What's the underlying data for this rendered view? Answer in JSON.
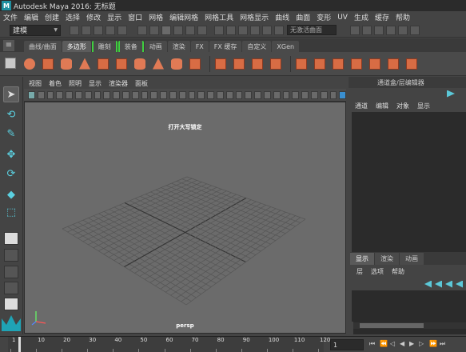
{
  "window": {
    "title": "Autodesk Maya 2016: 无标题",
    "app_icon_letter": "M"
  },
  "menubar": {
    "items": [
      "文件",
      "编辑",
      "创建",
      "选择",
      "修改",
      "显示",
      "窗口",
      "网格",
      "编辑网格",
      "网格工具",
      "网格显示",
      "曲线",
      "曲面",
      "变形",
      "UV",
      "生成",
      "缓存",
      "帮助"
    ]
  },
  "statusline": {
    "mode": "建模",
    "live_surface": "无激活曲面"
  },
  "shelf": {
    "tabs": [
      "曲线/曲面",
      "多边形",
      "雕刻",
      "装备",
      "动画",
      "渲染",
      "FX",
      "FX 缓存",
      "自定义",
      "XGen"
    ],
    "active_tab": "多边形",
    "icons": [
      "poly-sphere-icon",
      "poly-cube-icon",
      "poly-cylinder-icon",
      "poly-cone-icon",
      "poly-torus-icon",
      "poly-plane-icon",
      "poly-disc-icon",
      "poly-pyramid-icon",
      "poly-pipe-icon",
      "poly-helix-icon",
      "combine-icon",
      "separate-icon",
      "extract-icon",
      "booleans-icon",
      "smooth-icon",
      "mirror-icon",
      "bevel-icon",
      "bridge-icon",
      "extrude-icon",
      "append-icon",
      "multicut-icon",
      "target-weld-icon",
      "wedge-icon",
      "bevel-tool-icon",
      "planar-uv-icon",
      "automatic-uv-icon"
    ]
  },
  "panel": {
    "menus": [
      "视图",
      "着色",
      "照明",
      "显示",
      "渲染器",
      "面板"
    ],
    "hud_message": "打开大写锁定",
    "camera_name": "persp"
  },
  "channel_box": {
    "title": "通道盒/层编辑器",
    "menus": [
      "通道",
      "编辑",
      "对象",
      "显示"
    ]
  },
  "layer_editor": {
    "tabs": [
      "显示",
      "渲染",
      "动画"
    ],
    "active_tab": "显示",
    "menus": [
      "层",
      "选项",
      "帮助"
    ]
  },
  "timeline": {
    "ticks": [
      "1",
      "10",
      "20",
      "30",
      "40",
      "50",
      "60",
      "70",
      "80",
      "90",
      "100",
      "110",
      "120"
    ],
    "current_frame": "1"
  },
  "colors": {
    "accent": "#5bc8d8",
    "shelf_green": "#3fcf3f",
    "poly_orange": "#e07a55"
  }
}
